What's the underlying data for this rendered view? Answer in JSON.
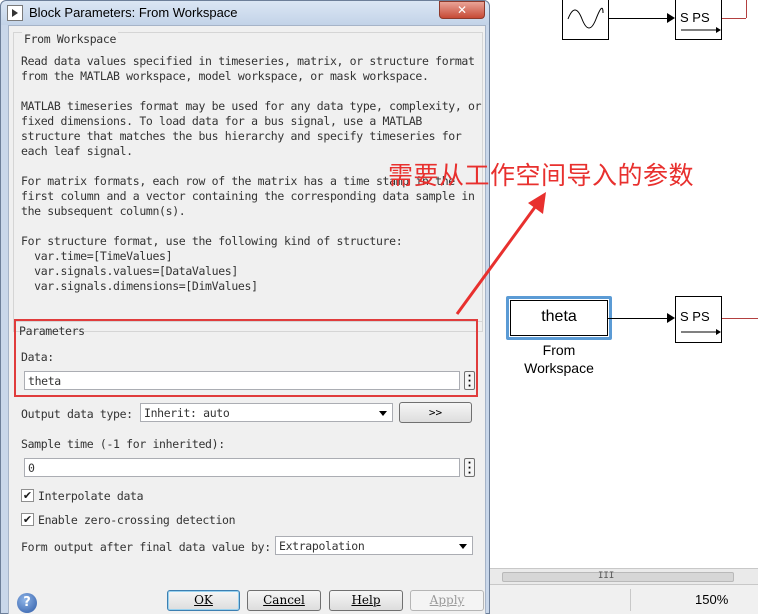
{
  "dialog": {
    "title": "Block Parameters: From Workspace",
    "close_label": "✕",
    "section_title": "From Workspace",
    "description": [
      "Read data values specified in timeseries, matrix, or structure format\nfrom the MATLAB workspace, model workspace, or mask workspace.",
      "MATLAB timeseries format may be used for any data type, complexity, or\nfixed dimensions. To load data for a bus signal, use a MATLAB\nstructure that matches the bus hierarchy and specify timeseries for\neach leaf signal.",
      "For matrix formats, each row of the matrix has a time stamp in the\nfirst column and a vector containing the corresponding data sample in\nthe subsequent column(s).",
      "For structure format, use the following kind of structure:\n  var.time=[TimeValues]\n  var.signals.values=[DataValues]\n  var.signals.dimensions=[DimValues]"
    ],
    "parameters_title": "Parameters",
    "data_label": "Data:",
    "data_value": "theta",
    "output_type_label": "Output data type:",
    "output_type_value": "Inherit: auto",
    "assistant_button": ">>",
    "sample_time_label": "Sample time (-1 for inherited):",
    "sample_time_value": "0",
    "interpolate_label": "Interpolate data",
    "interpolate_checked": true,
    "zero_crossing_label": "Enable zero-crossing detection",
    "zero_crossing_checked": true,
    "final_value_label": "Form output after final data value by:",
    "final_value_value": "Extrapolation",
    "buttons": {
      "ok": "OK",
      "cancel": "Cancel",
      "help": "Help",
      "apply": "Apply"
    }
  },
  "annotation": {
    "text": "需要从工作空间导入的参数",
    "color": "#e8302e"
  },
  "model": {
    "from_workspace_block_text": "theta",
    "from_workspace_caption": "From\nWorkspace",
    "ps_converter_label": "S PS",
    "zoom": "150%",
    "scroll_grip": "III"
  },
  "colors": {
    "selection_outline": "#5b9bd5",
    "annotation_red": "#e03c3c",
    "titlebar": "#c9d7ea"
  }
}
